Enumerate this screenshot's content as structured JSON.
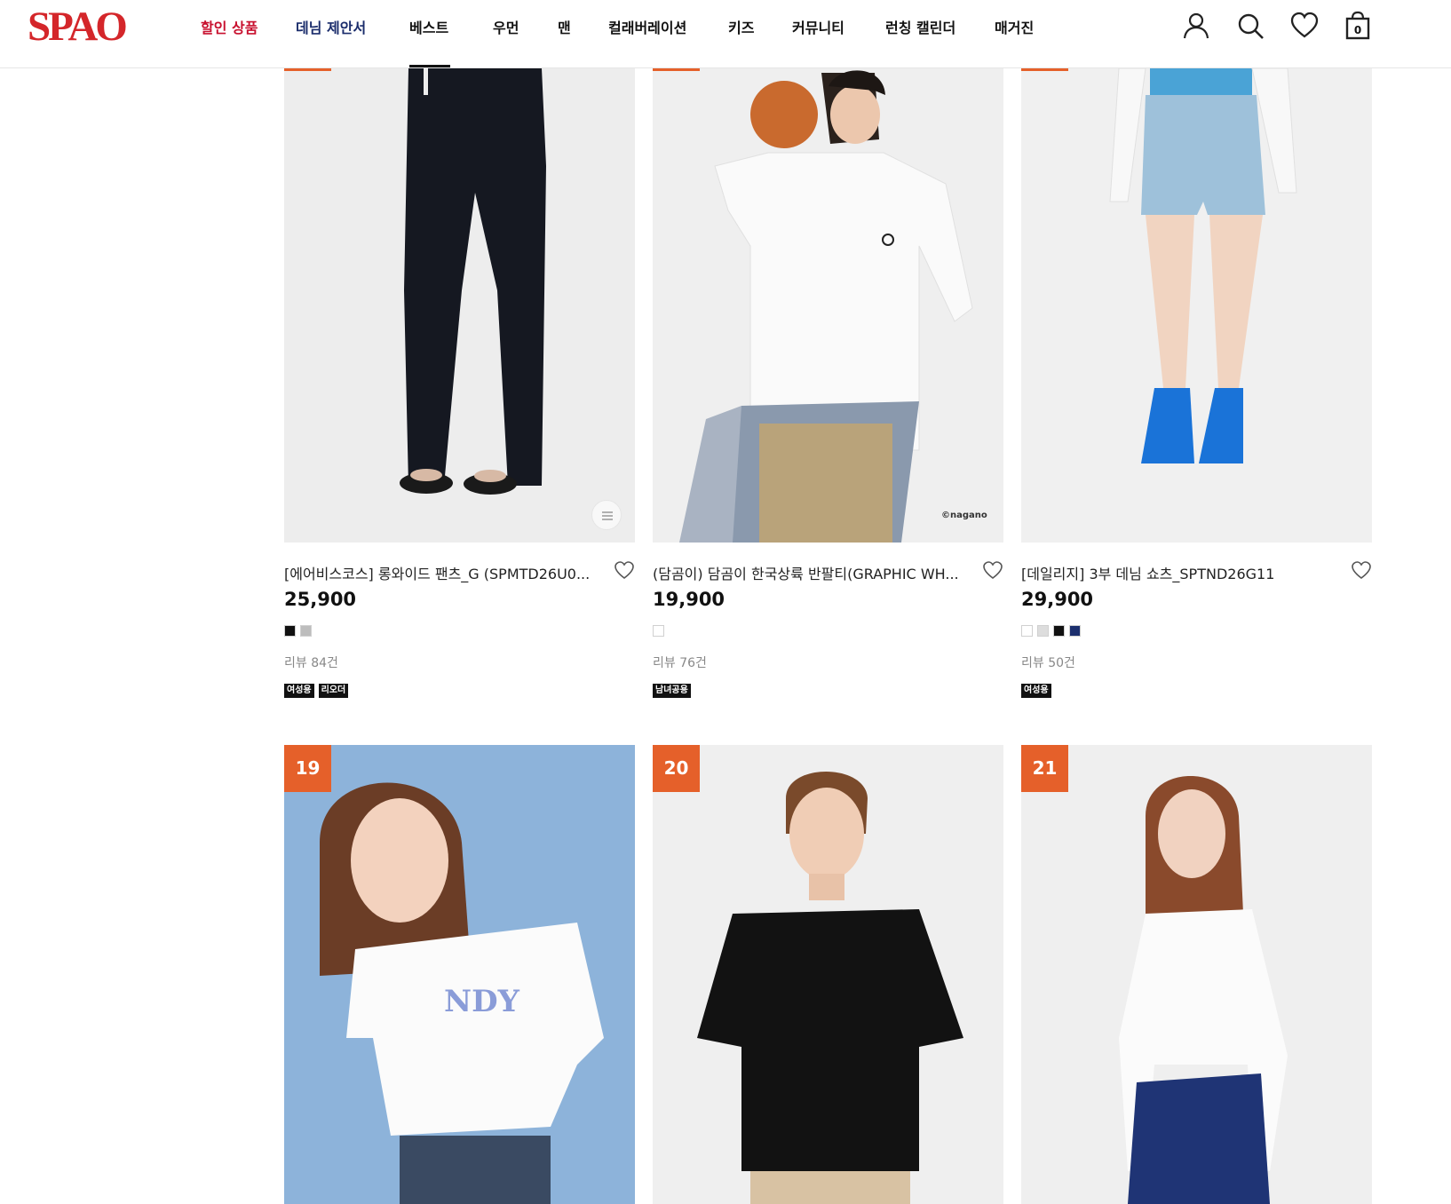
{
  "header": {
    "logo": "SPAO",
    "nav": [
      {
        "label": "할인 상품"
      },
      {
        "label": "데님 제안서"
      },
      {
        "label": "베스트"
      },
      {
        "label": "우먼"
      },
      {
        "label": "맨"
      },
      {
        "label": "컬래버레이션"
      },
      {
        "label": "키즈"
      },
      {
        "label": "커뮤니티"
      },
      {
        "label": "런칭 캘린더"
      },
      {
        "label": "매거진"
      }
    ],
    "icons": [
      "user-icon",
      "search-icon",
      "heart-icon",
      "shopping-bag-icon"
    ],
    "cart_count": "0",
    "colors": {
      "logo": "#d4262a",
      "sale": "#c8102e",
      "denim": "#1a2c6b"
    }
  },
  "products": [
    {
      "title": "[에어비스코스] 롱와이드 팬츠_G (SPMTD26U0...",
      "price": "25,900",
      "swatches": [
        "#111111",
        "#bdbdbd"
      ],
      "review": "리뷰 84건",
      "tags": [
        "여성용",
        "리오더"
      ]
    },
    {
      "title": "(담곰이) 담곰이 한국상륙 반팔티(GRAPHIC WH...",
      "price": "19,900",
      "swatches": [
        "#ffffff"
      ],
      "review": "리뷰 76건",
      "tags": [
        "남녀공용"
      ],
      "watermark": "©nagano"
    },
    {
      "title": "[데일리지] 3부 데님 쇼츠_SPTND26G11",
      "price": "29,900",
      "swatches": [
        "#ffffff",
        "#dddddd",
        "#111111",
        "#1c2f6e"
      ],
      "review": "리뷰 50건",
      "tags": [
        "여성용"
      ]
    },
    {
      "rank": "19"
    },
    {
      "rank": "20"
    },
    {
      "rank": "21"
    }
  ],
  "accent": "#e5602a"
}
